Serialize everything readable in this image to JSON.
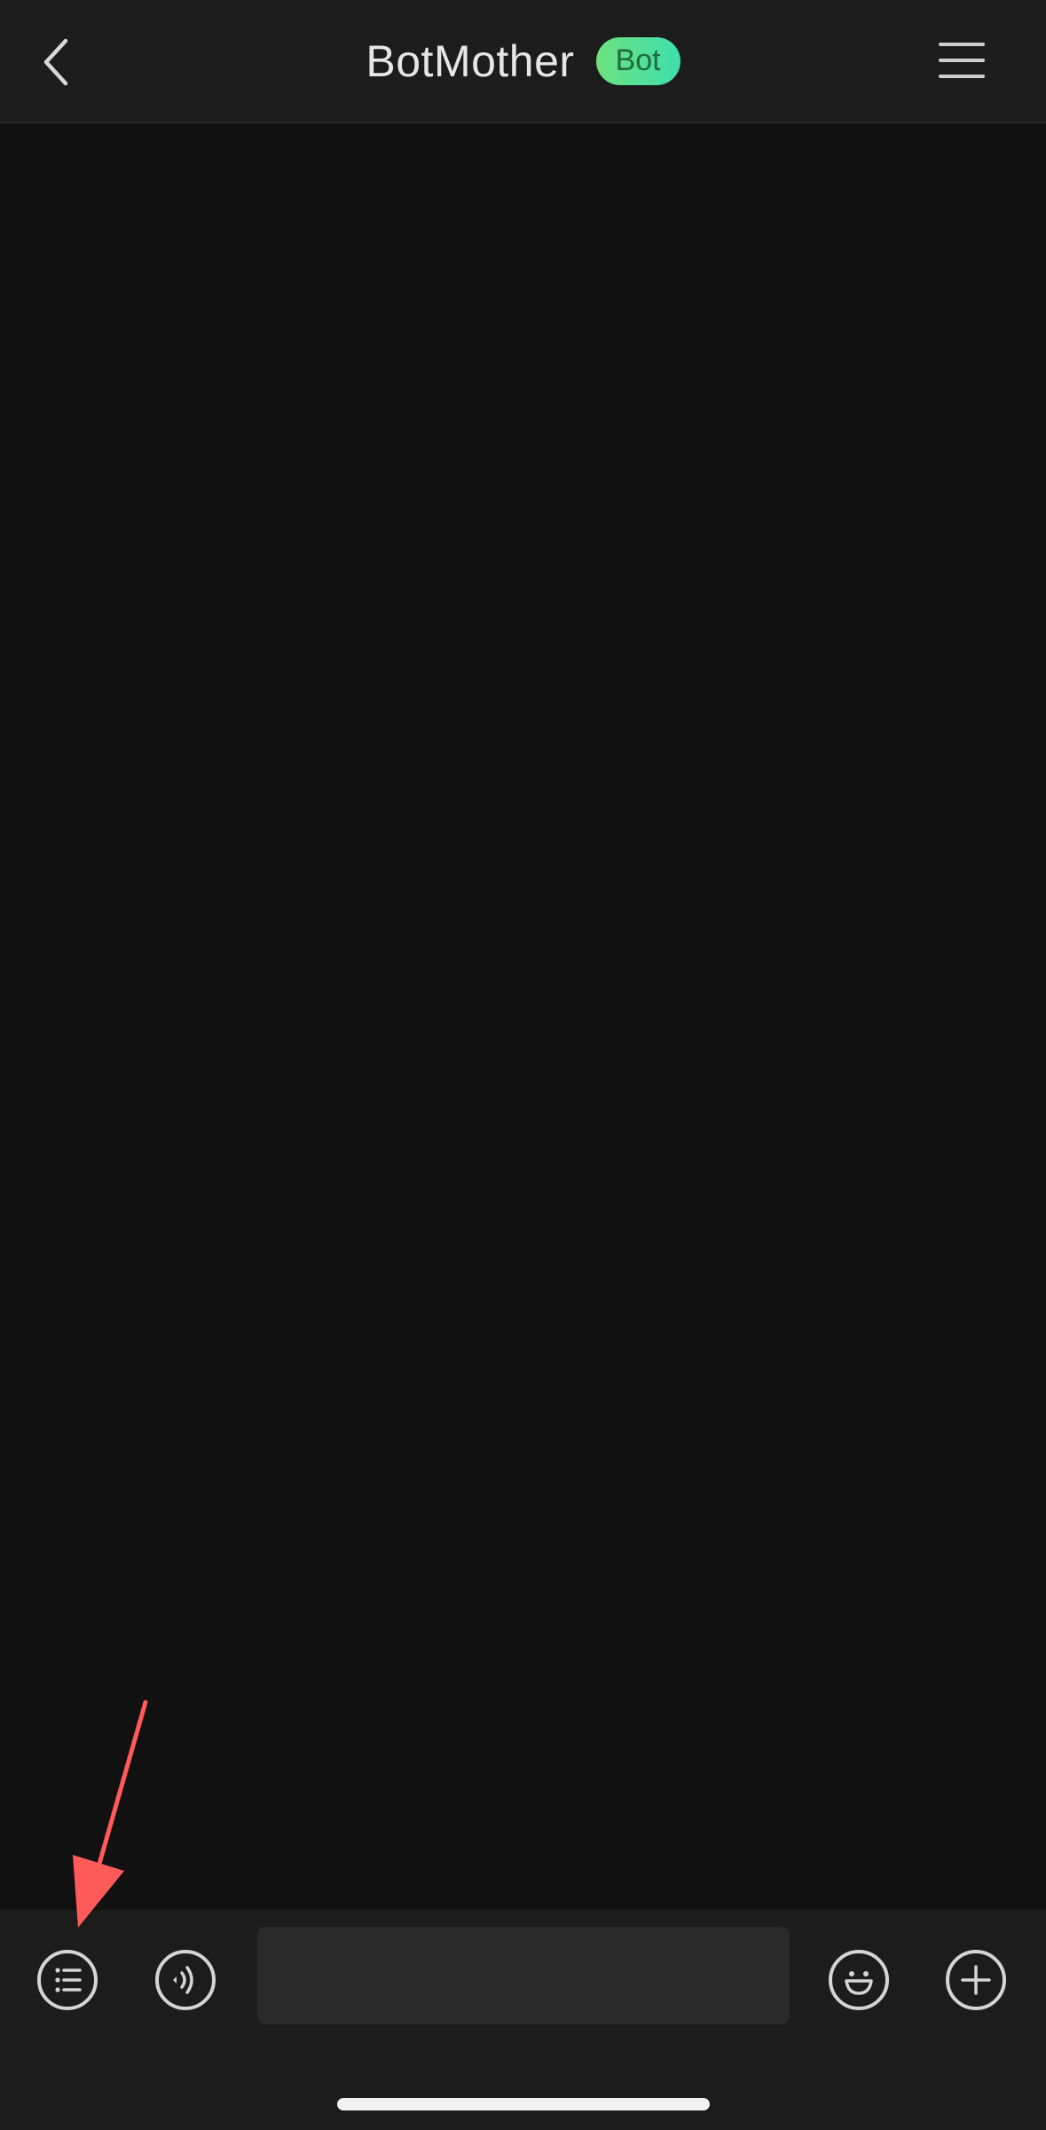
{
  "header": {
    "title": "BotMother",
    "badge": "Bot",
    "back_icon": "chevron-left-icon",
    "menu_icon": "hamburger-menu-icon"
  },
  "composer": {
    "input_value": "",
    "input_placeholder": "",
    "buttons": [
      {
        "icon": "list-menu-icon"
      },
      {
        "icon": "voice-icon"
      },
      {
        "icon": "emoji-icon"
      },
      {
        "icon": "plus-icon"
      }
    ]
  },
  "colors": {
    "background": "#111111",
    "bar": "#1c1c1c",
    "badge_start": "#6ee07f",
    "badge_end": "#3ddfae",
    "annotation_arrow": "#ff5a5a"
  }
}
